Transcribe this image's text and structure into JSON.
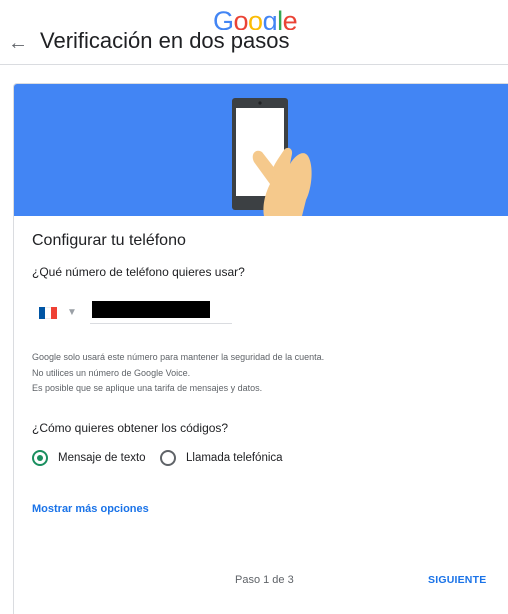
{
  "brand": {
    "logo_text": "Google"
  },
  "header": {
    "back_icon": "arrow-left-icon",
    "title": "Verificación en dos pasos"
  },
  "card": {
    "title": "Configurar tu teléfono",
    "phone_question": "¿Qué número de teléfono quieres usar?",
    "country": {
      "flag": "france-flag-icon",
      "caret": "▼"
    },
    "phone_value": "",
    "info_lines": [
      "Google solo usará este número para mantener la seguridad de la cuenta.",
      "No utilices un número de Google Voice.",
      "Es posible que se aplique una tarifa de mensajes y datos."
    ],
    "code_question": "¿Cómo quieres obtener los códigos?",
    "options": [
      {
        "label": "Mensaje de texto",
        "selected": true
      },
      {
        "label": "Llamada telefónica",
        "selected": false
      }
    ],
    "more_options": "Mostrar más opciones",
    "step": "Paso 1 de 3",
    "next_label": "SIGUIENTE"
  },
  "colors": {
    "banner": "#4285F4",
    "accent": "#1a73e8",
    "radio_selected": "#1a8f5f"
  }
}
